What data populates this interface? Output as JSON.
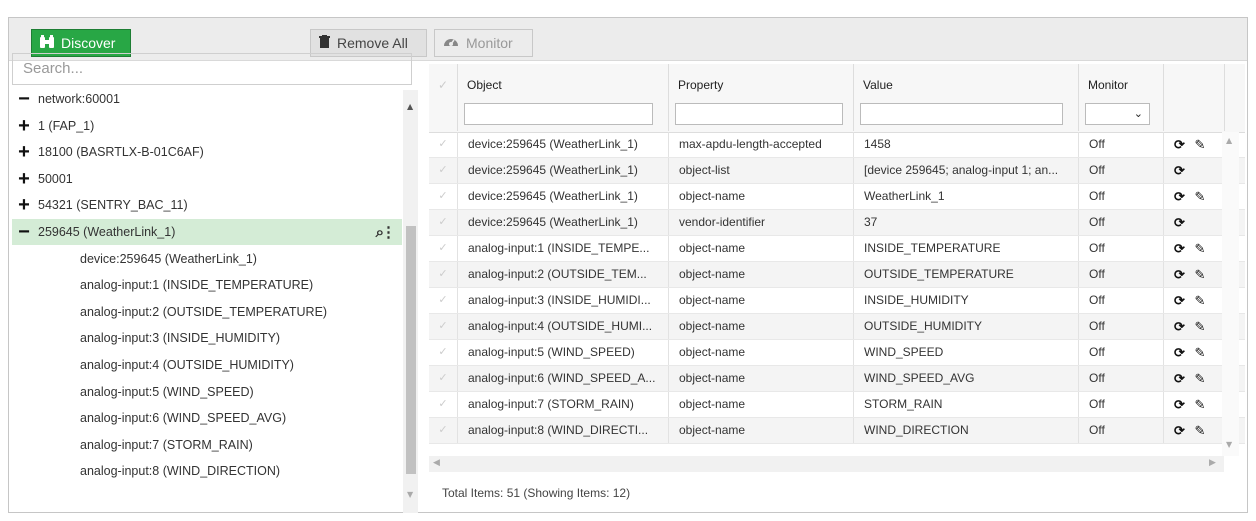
{
  "toolbar": {
    "discover_label": "Discover",
    "remove_all_label": "Remove All",
    "monitor_label": "Monitor"
  },
  "search": {
    "placeholder": "Search..."
  },
  "tree": [
    {
      "toggle": "−",
      "label": "network:60001",
      "indent": 0
    },
    {
      "toggle": "+",
      "label": "1 (FAP_1)",
      "indent": 0
    },
    {
      "toggle": "+",
      "label": "18100 (BASRTLX-B-01C6AF)",
      "indent": 0
    },
    {
      "toggle": "+",
      "label": "50001",
      "indent": 0
    },
    {
      "toggle": "+",
      "label": "54321 (SENTRY_BAC_11)",
      "indent": 0
    },
    {
      "toggle": "−",
      "label": "259645 (WeatherLink_1)",
      "indent": 0,
      "selected": true
    },
    {
      "label": "device:259645 (WeatherLink_1)",
      "indent": 1
    },
    {
      "label": "analog-input:1 (INSIDE_TEMPERATURE)",
      "indent": 1
    },
    {
      "label": "analog-input:2 (OUTSIDE_TEMPERATURE)",
      "indent": 1
    },
    {
      "label": "analog-input:3 (INSIDE_HUMIDITY)",
      "indent": 1
    },
    {
      "label": "analog-input:4 (OUTSIDE_HUMIDITY)",
      "indent": 1
    },
    {
      "label": "analog-input:5 (WIND_SPEED)",
      "indent": 1
    },
    {
      "label": "analog-input:6 (WIND_SPEED_AVG)",
      "indent": 1
    },
    {
      "label": "analog-input:7 (STORM_RAIN)",
      "indent": 1
    },
    {
      "label": "analog-input:8 (WIND_DIRECTION)",
      "indent": 1
    }
  ],
  "table": {
    "headers": {
      "object": "Object",
      "property": "Property",
      "value": "Value",
      "monitor": "Monitor"
    },
    "rows": [
      {
        "object": "device:259645 (WeatherLink_1)",
        "property": "max-apdu-length-accepted",
        "value": "1458",
        "monitor": "Off",
        "editable": true
      },
      {
        "object": "device:259645 (WeatherLink_1)",
        "property": "object-list",
        "value": "[device 259645; analog-input 1; an...",
        "monitor": "Off",
        "editable": false
      },
      {
        "object": "device:259645 (WeatherLink_1)",
        "property": "object-name",
        "value": "WeatherLink_1",
        "monitor": "Off",
        "editable": true
      },
      {
        "object": "device:259645 (WeatherLink_1)",
        "property": "vendor-identifier",
        "value": "37",
        "monitor": "Off",
        "editable": false
      },
      {
        "object": "analog-input:1 (INSIDE_TEMPE...",
        "property": "object-name",
        "value": "INSIDE_TEMPERATURE",
        "monitor": "Off",
        "editable": true
      },
      {
        "object": "analog-input:2 (OUTSIDE_TEM...",
        "property": "object-name",
        "value": "OUTSIDE_TEMPERATURE",
        "monitor": "Off",
        "editable": true
      },
      {
        "object": "analog-input:3 (INSIDE_HUMIDI...",
        "property": "object-name",
        "value": "INSIDE_HUMIDITY",
        "monitor": "Off",
        "editable": true
      },
      {
        "object": "analog-input:4 (OUTSIDE_HUMI...",
        "property": "object-name",
        "value": "OUTSIDE_HUMIDITY",
        "monitor": "Off",
        "editable": true
      },
      {
        "object": "analog-input:5 (WIND_SPEED)",
        "property": "object-name",
        "value": "WIND_SPEED",
        "monitor": "Off",
        "editable": true
      },
      {
        "object": "analog-input:6 (WIND_SPEED_A...",
        "property": "object-name",
        "value": "WIND_SPEED_AVG",
        "monitor": "Off",
        "editable": true
      },
      {
        "object": "analog-input:7 (STORM_RAIN)",
        "property": "object-name",
        "value": "STORM_RAIN",
        "monitor": "Off",
        "editable": true
      },
      {
        "object": "analog-input:8 (WIND_DIRECTI...",
        "property": "object-name",
        "value": "WIND_DIRECTION",
        "monitor": "Off",
        "editable": true
      }
    ]
  },
  "footer": {
    "text": "Total Items: 51 (Showing Items: 12)"
  },
  "colors": {
    "discover": "#28a745",
    "selected_row": "#d4ecd6"
  }
}
